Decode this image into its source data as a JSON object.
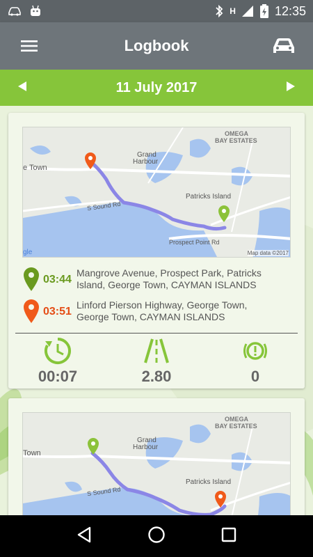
{
  "status_bar": {
    "time": "12:35",
    "network": "H"
  },
  "app_bar": {
    "title": "Logbook"
  },
  "date_bar": {
    "date": "11 July 2017"
  },
  "map": {
    "labels": {
      "omega": "OMEGA",
      "bay_estates": "BAY ESTATES",
      "grand": "Grand",
      "harbour": "Harbour",
      "patricks_island": "Patricks Island",
      "town": "e Town",
      "town2": "Town",
      "s_sound_rd": "S Sound Rd",
      "prospect_point_rd": "Prospect Point Rd",
      "map_data": "Map data ©2017",
      "google": "gle"
    }
  },
  "trips": [
    {
      "start": {
        "time": "03:44",
        "address": "Mangrove Avenue, Prospect Park, Patricks Island, George Town, CAYMAN ISLANDS"
      },
      "end": {
        "time": "03:51",
        "address": "Linford Pierson Highway, George Town, George Town, CAYMAN ISLANDS"
      },
      "stats": {
        "duration": "00:07",
        "distance": "2.80",
        "alerts": "0"
      }
    }
  ],
  "colors": {
    "accent_green": "#86c53a",
    "start_pin": "#6a9a1f",
    "end_pin": "#f05a1a",
    "route": "#8b86e6"
  }
}
